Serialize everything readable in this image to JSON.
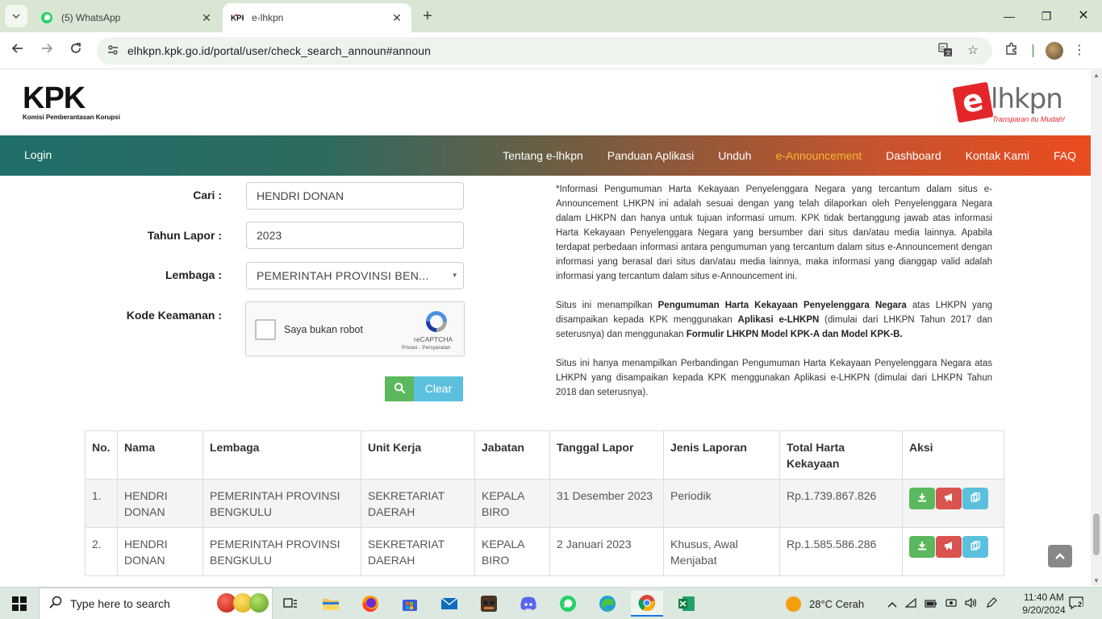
{
  "browser": {
    "tabs": [
      {
        "title": "(5) WhatsApp",
        "active": false
      },
      {
        "title": "e-lhkpn",
        "active": true
      }
    ],
    "url": "elhkpn.kpk.go.id/portal/user/check_search_announ#announ",
    "colors": {
      "tabstrip": "#d8e6d3",
      "accent": "#1a73e8"
    }
  },
  "header": {
    "kpk_logo_text": "KPK",
    "kpk_subtitle": "Komisi Pemberantasan Korupsi",
    "elhkpn_e": "e",
    "elhkpn_rest": "lhkpn",
    "elhkpn_tagline": "Transparan itu Mudah!"
  },
  "nav": {
    "login": "Login",
    "items": [
      "Tentang e-lhkpn",
      "Panduan Aplikasi",
      "Unduh",
      "e-Announcement",
      "Dashboard",
      "Kontak Kami",
      "FAQ"
    ],
    "active_index": 3,
    "active_color": "#f7b733"
  },
  "form": {
    "cari_label": "Cari :",
    "cari_value": "HENDRI DONAN",
    "tahun_label": "Tahun Lapor :",
    "tahun_value": "2023",
    "lembaga_label": "Lembaga :",
    "lembaga_value": "PEMERINTAH PROVINSI BEN...",
    "kode_label": "Kode Keamanan :",
    "captcha_text": "Saya bukan robot",
    "captcha_brand": "reCAPTCHA",
    "captcha_links": "Privasi - Persyaratan",
    "clear_label": "Clear"
  },
  "info": {
    "p1": "*Informasi Pengumuman Harta Kekayaan Penyelenggara Negara yang tercantum dalam situs e-Announcement LHKPN ini adalah sesuai dengan yang telah dilaporkan oleh Penyelenggara Negara dalam LHKPN dan hanya untuk tujuan informasi umum. KPK tidak bertanggung jawab atas informasi Harta Kekayaan Penyelenggara Negara yang bersumber dari situs dan/atau media lainnya. Apabila terdapat perbedaan informasi antara pengumuman yang tercantum dalam situs e-Announcement dengan informasi yang berasal dari situs dan/atau media lainnya, maka informasi yang dianggap valid adalah informasi yang tercantum dalam situs e-Announcement ini.",
    "p2_a": "Situs ini menampilkan ",
    "p2_b": "Pengumuman Harta Kekayaan Penyelenggara Negara",
    "p2_c": " atas LHKPN yang disampaikan kepada KPK menggunakan ",
    "p2_d": "Aplikasi e-LHKPN",
    "p2_e": " (dimulai dari LHKPN Tahun 2017 dan seterusnya) dan menggunakan ",
    "p2_f": "Formulir LHKPN Model KPK-A dan Model KPK-B.",
    "p3": "Situs ini hanya menampilkan Perbandingan Pengumuman Harta Kekayaan Penyelenggara Negara atas LHKPN yang disampaikan kepada KPK menggunakan Aplikasi e-LHKPN (dimulai dari LHKPN Tahun 2018 dan seterusnya)."
  },
  "table": {
    "headers": [
      "No.",
      "Nama",
      "Lembaga",
      "Unit Kerja",
      "Jabatan",
      "Tanggal Lapor",
      "Jenis Laporan",
      "Total Harta Kekayaan",
      "Aksi"
    ],
    "rows": [
      [
        "1.",
        "HENDRI DONAN",
        "PEMERINTAH PROVINSI BENGKULU",
        "SEKRETARIAT DAERAH",
        "KEPALA BIRO",
        "31 Desember 2023",
        "Periodik",
        "Rp.1.739.867.826"
      ],
      [
        "2.",
        "HENDRI DONAN",
        "PEMERINTAH PROVINSI BENGKULU",
        "SEKRETARIAT DAERAH",
        "KEPALA BIRO",
        "2 Januari 2023",
        "Khusus, Awal Menjabat",
        "Rp.1.585.586.286"
      ]
    ]
  },
  "taskbar": {
    "search_placeholder": "Type here to search",
    "weather": "28°C  Cerah",
    "time": "11:40 AM",
    "date": "9/20/2024",
    "notifications": "2"
  }
}
